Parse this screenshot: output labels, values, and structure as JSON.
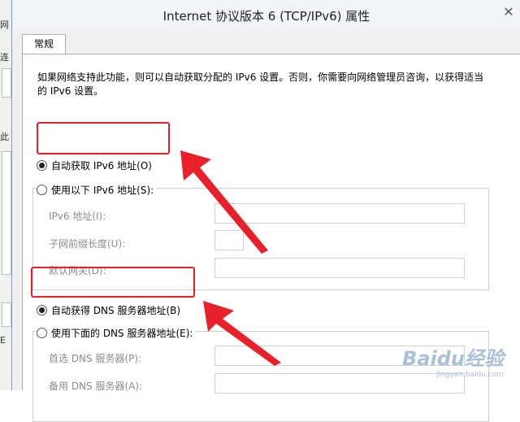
{
  "background_window": {
    "fragment_1": "网",
    "fragment_2": "连",
    "fragment_3": "此",
    "fragment_4": "E"
  },
  "dialog": {
    "title": "Internet 协议版本 6 (TCP/IPv6) 属性",
    "close_icon": "close-icon",
    "tabs": [
      {
        "label": "常规",
        "selected": true
      }
    ],
    "description": "如果网络支持此功能，则可以自动获取分配的 IPv6 设置。否则，你需要向网络管理员咨询，以获得适当的 IPv6 设置。",
    "ip": {
      "auto_label": "自动获取 IPv6 地址(O)",
      "auto_selected": true,
      "manual_label": "使用以下 IPv6 地址(S):",
      "manual_selected": false,
      "fields": [
        {
          "label": "IPv6 地址(I):",
          "value": ""
        },
        {
          "label": "子网前缀长度(U):",
          "value": ""
        },
        {
          "label": "默认网关(D):",
          "value": ""
        }
      ]
    },
    "dns": {
      "auto_label": "自动获得 DNS 服务器地址(B)",
      "auto_selected": true,
      "manual_label": "使用下面的 DNS 服务器地址(E):",
      "manual_selected": false,
      "fields": [
        {
          "label": "首选 DNS 服务器(P):",
          "value": ""
        },
        {
          "label": "备用 DNS 服务器(A):",
          "value": ""
        }
      ]
    }
  },
  "annotations": {
    "highlight_color": "#e8202a"
  },
  "watermark": {
    "brand": "Baidu经验",
    "url": "jingyan.baidu.com"
  }
}
